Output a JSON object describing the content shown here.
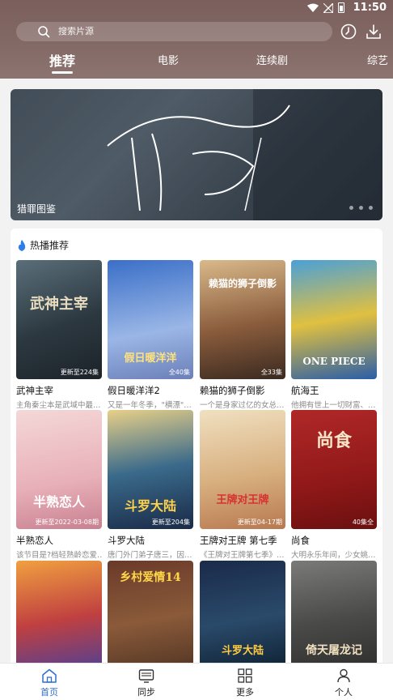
{
  "status_bar": {
    "time": "11:50"
  },
  "search": {
    "placeholder": "搜索片源"
  },
  "tabs": [
    {
      "label": "推荐"
    },
    {
      "label": "电影"
    },
    {
      "label": "连续剧"
    },
    {
      "label": "综艺"
    }
  ],
  "banner": {
    "title": "猎罪图鉴",
    "art_text": "猎罪"
  },
  "section": {
    "title": "热播推荐"
  },
  "cards": [
    {
      "title": "武神主宰",
      "desc": "主角秦尘本是武域中最…",
      "badge": "更新至224集",
      "art": "武神主宰"
    },
    {
      "title": "假日暖洋洋2",
      "desc": "又是一年冬季，\"横漂\"…",
      "badge": "全40集",
      "art": "假日暖洋洋"
    },
    {
      "title": "赖猫的狮子倒影",
      "desc": "一个是身家过亿的女总…",
      "badge": "全33集",
      "art": "赖猫的狮子倒影"
    },
    {
      "title": "航海王",
      "desc": "他拥有世上一切财富、…",
      "badge": "",
      "art": "ONE PIECE"
    },
    {
      "title": "半熟恋人",
      "desc": "该节目是?档轻熟龄恋爱…",
      "badge": "更新至2022-03-08期",
      "art": "半熟恋人"
    },
    {
      "title": "斗罗大陆",
      "desc": "唐门外门弟子唐三，因…",
      "badge": "更新至204集",
      "art": "斗罗大陆"
    },
    {
      "title": "王牌对王牌 第七季",
      "desc": "《王牌对王牌第七季》…",
      "badge": "更新至04-17期",
      "art": "王牌对王牌"
    },
    {
      "title": "尚食",
      "desc": "大明永乐年间，少女姚…",
      "badge": "40集全",
      "art": "尚食"
    },
    {
      "title": "",
      "desc": "",
      "badge": "",
      "art": ""
    },
    {
      "title": "",
      "desc": "",
      "badge": "",
      "art": "乡村爱情14"
    },
    {
      "title": "",
      "desc": "",
      "badge": "",
      "art": "斗罗大陆"
    },
    {
      "title": "",
      "desc": "",
      "badge": "",
      "art": "倚天屠龙记"
    }
  ],
  "nav": [
    {
      "label": "首页"
    },
    {
      "label": "同步"
    },
    {
      "label": "更多"
    },
    {
      "label": "个人"
    }
  ],
  "colors": {
    "active_nav": "#2d6fd1",
    "fire": "#2d7ee8"
  }
}
